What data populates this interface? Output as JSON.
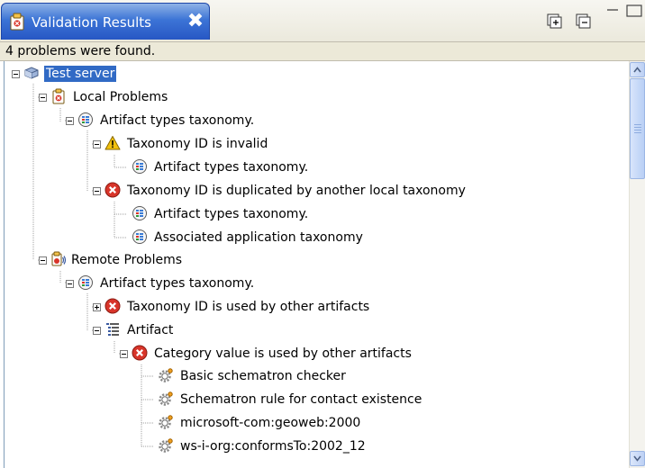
{
  "view": {
    "title": "Validation Results",
    "close_glyph": "✖",
    "toolbar": [
      "expand-all-icon",
      "collapse-all-icon",
      "minimize-icon",
      "maximize-icon"
    ]
  },
  "status_text": "4 problems were found.",
  "colors": {
    "tab_blue": "#3c74d6",
    "selection": "#316ac5",
    "error_red": "#d8352a",
    "warning_yellow": "#f2c10f"
  },
  "tree": {
    "server": "Test server",
    "local": {
      "label": "Local Problems",
      "taxonomy": "Artifact types taxonomy.",
      "invalid": {
        "label": "Taxonomy ID is invalid",
        "child": "Artifact types taxonomy."
      },
      "duplicated": {
        "label": "Taxonomy ID is duplicated by another local taxonomy",
        "children": [
          "Artifact types taxonomy.",
          "Associated application taxonomy"
        ]
      }
    },
    "remote": {
      "label": "Remote Problems",
      "taxonomy": "Artifact types taxonomy.",
      "used": "Taxonomy ID is used by other artifacts",
      "artifact": "Artifact",
      "category": {
        "label": "Category value is used by other artifacts",
        "children": [
          "Basic schematron checker",
          "Schematron rule for contact existence",
          "microsoft-com:geoweb:2000",
          "ws-i-org:conformsTo:2002_12"
        ]
      }
    }
  }
}
